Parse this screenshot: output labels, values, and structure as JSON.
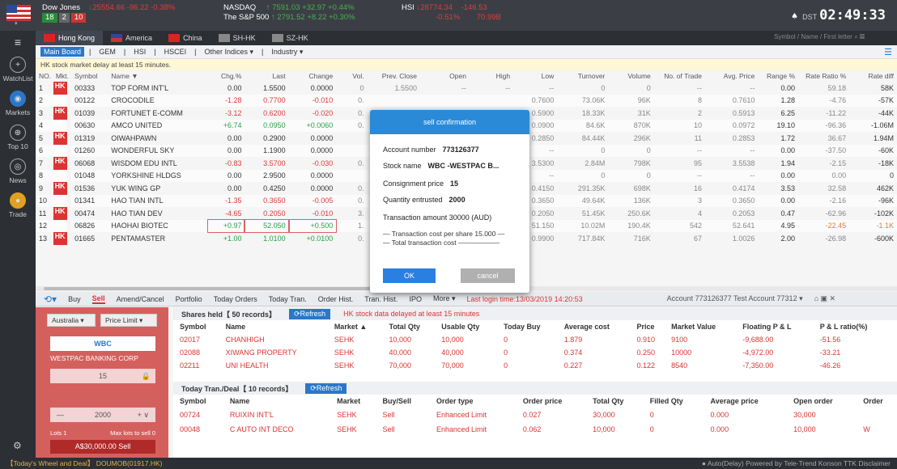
{
  "header": {
    "dow": {
      "name": "Dow Jones",
      "price": "↓25554.66",
      "chg": "-96.22",
      "pct": "-0.38%",
      "adv": "18",
      "flat": "2",
      "dec": "10"
    },
    "nasdaq": {
      "name": "NASDAQ",
      "price": "↑ 7591.03",
      "chg": "+32.97",
      "pct": "+0.44%"
    },
    "sp": {
      "name": "The S&P 500",
      "price": "↑ 2791.52",
      "chg": "+8.22",
      "pct": "+0.30%"
    },
    "hsi": {
      "name": "HSI",
      "price": "↓28774.34",
      "chg": "-146.53",
      "pct": "-0.51%",
      "vol": "70.99B"
    },
    "clock_tz": "DST",
    "clock": "02:49:33",
    "bell": "♠"
  },
  "markets": [
    "Hong Kong",
    "America",
    "China",
    "SH-HK",
    "SZ-HK"
  ],
  "search_placeholder": "Symbol / Name / First letter",
  "sidebar": [
    {
      "icon": "+",
      "label": "WatchList"
    },
    {
      "icon": "◉",
      "label": "Markets"
    },
    {
      "icon": "⊕",
      "label": "Top 10"
    },
    {
      "icon": "◎",
      "label": "News"
    },
    {
      "icon": "●",
      "label": "Trade"
    }
  ],
  "subnav": [
    "Main Board",
    "GEM",
    "HSI",
    "HSCEI",
    "Other Indices ▾",
    "Industry ▾"
  ],
  "notice": "HK stock market delay at least 15 minutes.",
  "cols": [
    "NO.",
    "Mkt.",
    "Symbol",
    "Name ▼",
    "Chg.%",
    "Last",
    "Change",
    "Vol.",
    "Prev. Close",
    "Open",
    "High",
    "Low",
    "Turnover",
    "Volume",
    "No. of Trade",
    "Avg. Price",
    "Range %",
    "Rate Ratio %",
    "Rate diff"
  ],
  "rows": [
    [
      "1",
      "HK",
      "00333",
      "TOP FORM INT'L",
      "0.00",
      "1.5500",
      "0.0000",
      "0",
      "1.5500",
      "--",
      "--",
      "--",
      "0",
      "0",
      "--",
      "--",
      "0.00",
      "59.18",
      "58K"
    ],
    [
      "2",
      "HK",
      "00122",
      "CROCODILE",
      "-1.28",
      "0.7700",
      "-0.010",
      "0.",
      "",
      "",
      "",
      "0.7600",
      "73.06K",
      "96K",
      "8",
      "0.7610",
      "1.28",
      "-4.76",
      "-57K"
    ],
    [
      "3",
      "HK",
      "01039",
      "FORTUNET E-COMM",
      "-3.12",
      "0.6200",
      "-0.020",
      "0.",
      "",
      "",
      "",
      "0.5900",
      "18.33K",
      "31K",
      "2",
      "0.5913",
      "6.25",
      "-11.22",
      "-44K"
    ],
    [
      "4",
      "HK",
      "00630",
      "AMCO UNITED",
      "+6.74",
      "0.0950",
      "+0.0060",
      "0.",
      "",
      "",
      "",
      "0.0900",
      "84.6K",
      "870K",
      "10",
      "0.0972",
      "19.10",
      "-96.36",
      "-1.06M"
    ],
    [
      "5",
      "HK",
      "01319",
      "OIWAHPAWN",
      "0.00",
      "0.2900",
      "0.0000",
      "",
      "",
      "",
      "",
      "0.2850",
      "84.44K",
      "296K",
      "11",
      "0.2853",
      "1.72",
      "36.67",
      "1.94M"
    ],
    [
      "6",
      "HK",
      "01260",
      "WONDERFUL SKY",
      "0.00",
      "1.1900",
      "0.0000",
      "",
      "",
      "",
      "",
      "--",
      "0",
      "0",
      "--",
      "--",
      "0.00",
      "-37.50",
      "-60K"
    ],
    [
      "7",
      "HK",
      "06068",
      "WISDOM EDU INTL",
      "-0.83",
      "3.5700",
      "-0.030",
      "0.",
      "",
      "",
      "",
      "3.5300",
      "2.84M",
      "798K",
      "95",
      "3.5538",
      "1.94",
      "-2.15",
      "-18K"
    ],
    [
      "8",
      "HK",
      "01048",
      "YORKSHINE HLDGS",
      "0.00",
      "2.9500",
      "0.0000",
      "",
      "",
      "",
      "",
      "--",
      "0",
      "0",
      "--",
      "--",
      "0.00",
      "0.00",
      "0"
    ],
    [
      "9",
      "HK",
      "01536",
      "YUK WING GP",
      "0.00",
      "0.4250",
      "0.0000",
      "0.",
      "",
      "",
      "",
      "0.4150",
      "291.35K",
      "698K",
      "16",
      "0.4174",
      "3.53",
      "32.58",
      "462K"
    ],
    [
      "10",
      "HK",
      "01341",
      "HAO TIAN INTL",
      "-1.35",
      "0.3650",
      "-0.005",
      "0.",
      "",
      "",
      "",
      "0.3650",
      "49.64K",
      "136K",
      "3",
      "0.3650",
      "0.00",
      "-2.16",
      "-96K"
    ],
    [
      "11",
      "HK",
      "00474",
      "HAO TIAN DEV",
      "-4.65",
      "0.2050",
      "-0.010",
      "3.",
      "",
      "",
      "",
      "0.2050",
      "51.45K",
      "250.6K",
      "4",
      "0.2053",
      "0.47",
      "-62.96",
      "-102K"
    ],
    [
      "12",
      "HK",
      "06826",
      "HAOHAI BIOTEC",
      "+0.97",
      "52.050",
      "+0.500",
      "1.",
      "",
      "",
      "",
      "51.150",
      "10.02M",
      "190.4K",
      "542",
      "52.641",
      "4.95",
      "-22.45",
      "-1.1K"
    ],
    [
      "13",
      "HK",
      "01665",
      "PENTAMASTER",
      "+1.00",
      "1.0100",
      "+0.0100",
      "0.",
      "",
      "",
      "",
      "0.9900",
      "717.84K",
      "716K",
      "67",
      "1.0026",
      "2.00",
      "-26.98",
      "-600K"
    ]
  ],
  "tradebar": {
    "tabs": [
      "Buy",
      "Sell",
      "Amend/Cancel",
      "Portfolio",
      "Today Orders",
      "Today Tran.",
      "Order Hist.",
      "Tran. Hist.",
      "IPO",
      "More ▾"
    ],
    "login": "Last login time:13/03/2019 14:20:53",
    "account": "Account  773126377 Test Account 77312 ▾"
  },
  "panel": {
    "market": "Australia ▾",
    "type": "Price Limit ▾",
    "code": "WBC",
    "company": "WESTPAC BANKING CORP",
    "price": "15",
    "qty": "2000",
    "lots": "Lots 1",
    "maxlots": "Max lots to sell 0",
    "sell": "A$30,000.00  Sell"
  },
  "shares": {
    "title": "Shares held【 50 records】",
    "refresh": "⟳Refresh",
    "delay": "HK stock data delayed at least 15 minutes",
    "cols": [
      "Symbol",
      "Name",
      "Market ▲",
      "Total Qty",
      "Usable Qty",
      "Today Buy",
      "Average cost",
      "Price",
      "Market Value",
      "Floating P & L",
      "P & L ratio(%)"
    ],
    "rows": [
      [
        "02017",
        "CHANHIGH",
        "SEHK",
        "10,000",
        "10,000",
        "0",
        "1.879",
        "0.910",
        "9100",
        "-9,688.00",
        "-51.56"
      ],
      [
        "02088",
        "XIWANG PROPERTY",
        "SEHK",
        "40,000",
        "40,000",
        "0",
        "0.374",
        "0.250",
        "10000",
        "-4,972.00",
        "-33.21"
      ],
      [
        "02211",
        "UNI HEALTH",
        "SEHK",
        "70,000",
        "70,000",
        "0",
        "0.227",
        "0.122",
        "8540",
        "-7,350.00",
        "-46.26"
      ]
    ]
  },
  "today": {
    "title": "Today Tran./Deal【 10 records】",
    "refresh": "⟳Refresh",
    "cols": [
      "Symbol",
      "Name",
      "Market",
      "Buy/Sell",
      "Order type",
      "Order price",
      "Total Qty",
      "Filled Qty",
      "Average price",
      "Open order",
      "Order"
    ],
    "rows": [
      [
        "00724",
        "RUIXIN INT'L",
        "SEHK",
        "Sell",
        "Enhanced Limit",
        "0.027",
        "30,000",
        "0",
        "0.000",
        "30,000",
        ""
      ],
      [
        "00048",
        "C AUTO INT DECO",
        "SEHK",
        "Sell",
        "Enhanced Limit",
        "0.062",
        "10,000",
        "0",
        "0.000",
        "10,000",
        "W"
      ]
    ]
  },
  "modal": {
    "title": "sell confirmation",
    "acct_l": "Account number",
    "acct": "773126377",
    "stock_l": "Stock name",
    "stock": "WBC -WESTPAC B...",
    "price_l": "Consignment price",
    "price": "15",
    "qty_l": "Quantity entrusted",
    "qty": "2000",
    "amt": "Transaction amount  30000 (AUD)",
    "cost_share": "— Transaction cost per share 15.000 —",
    "cost_total": "— Total transaction cost ——————",
    "ok": "OK",
    "cancel": "cancel"
  },
  "bottom": {
    "left": "【Today's Wheel and Deal】 DOUMOB(01917.HK)",
    "right": "● Auto(Delay)    Powered by Tele-Trend Konson   TTK  Disclaimer"
  }
}
